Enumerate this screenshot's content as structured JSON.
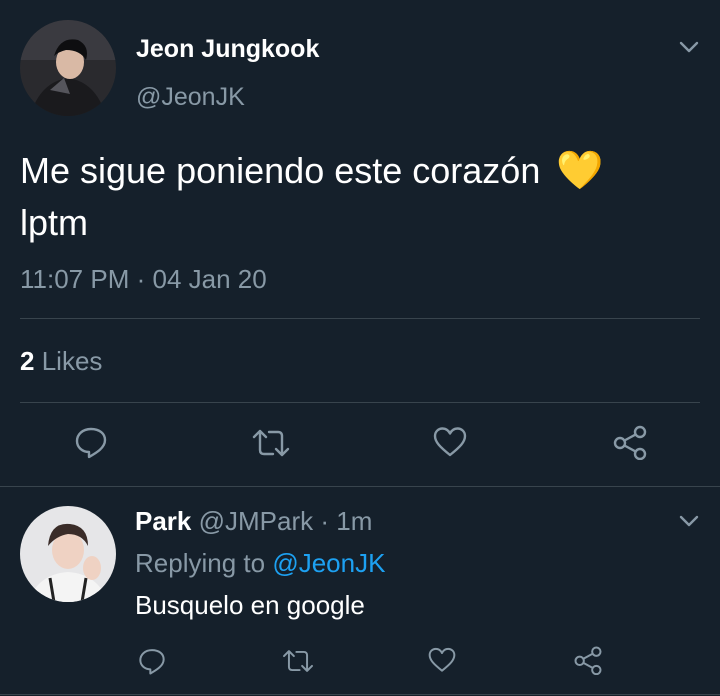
{
  "tweet": {
    "author_name": "Jeon Jungkook",
    "author_handle": "@JeonJK",
    "text": "Me sigue poniendo este corazón",
    "emoji": "💛",
    "text_line2": "lptm",
    "time": "11:07 PM",
    "separator": "·",
    "date": "04 Jan 20",
    "likes_count": "2",
    "likes_label": "Likes"
  },
  "reply": {
    "author_name": "Park",
    "author_handle": "@JMPark",
    "separator": "·",
    "age": "1m",
    "replying_to_label": "Replying to",
    "replying_to_handle": "@JeonJK",
    "text": "Busquelo en google"
  },
  "icons": {
    "menu": "chevron-down-icon",
    "reply": "comment-icon",
    "retweet": "retweet-icon",
    "like": "heart-icon",
    "share": "share-icon"
  },
  "colors": {
    "background": "#15202b",
    "muted": "#8899a6",
    "divider": "#38444d",
    "link": "#1da1f2",
    "emoji": "#ffcc4d"
  }
}
